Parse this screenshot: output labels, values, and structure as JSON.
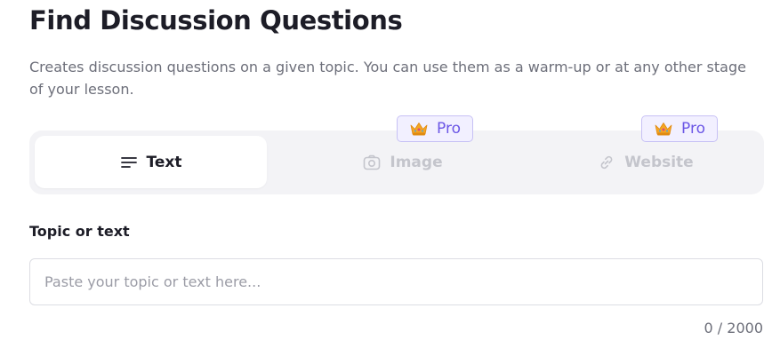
{
  "page": {
    "title": "Find Discussion Questions",
    "description": "Creates discussion questions on a given topic. You can use them as a warm-up or at any other stage of your lesson."
  },
  "tabs": [
    {
      "label": "Text",
      "icon": "text-lines-icon",
      "active": true,
      "pro": false
    },
    {
      "label": "Image",
      "icon": "camera-icon",
      "active": false,
      "pro": true
    },
    {
      "label": "Website",
      "icon": "link-icon",
      "active": false,
      "pro": true
    }
  ],
  "pro_badge": {
    "label": "Pro",
    "icon": "crown-icon"
  },
  "topic_field": {
    "label": "Topic or text",
    "value": "",
    "placeholder": "Paste your topic or text here...",
    "counter": "0 / 2000"
  },
  "colors": {
    "accent": "#6c57e6",
    "badge_bg": "#f2f0ff",
    "tab_bar_bg": "#f3f3f6",
    "text_primary": "#1d1d27",
    "text_muted": "#6d6f7a",
    "disabled": "#c4c5cc"
  }
}
